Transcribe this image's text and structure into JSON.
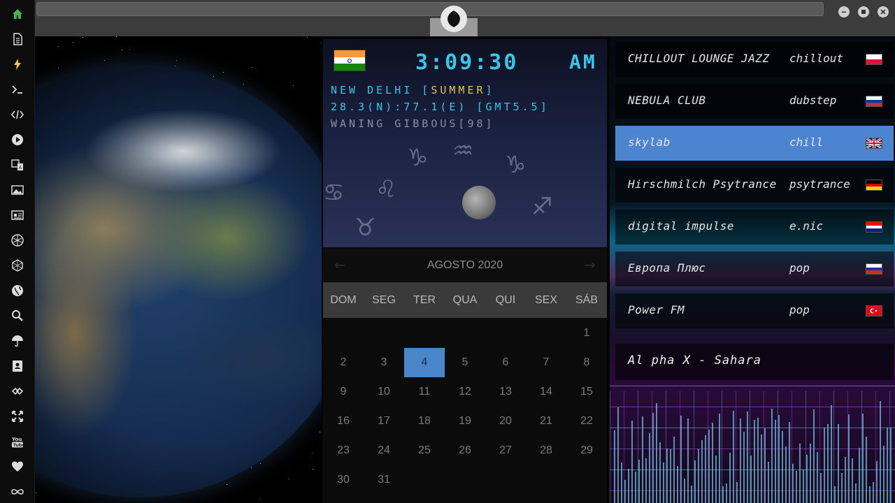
{
  "clock": {
    "time": "3:09:30",
    "ampm": "AM",
    "city_prefix": "NEW DELHI [",
    "season": "SUMMER",
    "city_suffix": "]",
    "coords": "28.3(N):77.1(E) [GMT5.5]",
    "moon": "WANING GIBBOUS[98]"
  },
  "calendar": {
    "month_label": "AGOSTO 2020",
    "weekdays": [
      "DOM",
      "SEG",
      "TER",
      "QUA",
      "QUI",
      "SEX",
      "SÁB"
    ],
    "today": 4,
    "days_in_month": 31,
    "first_weekday_index": 6,
    "prev_icon": "chevron-left-icon",
    "next_icon": "chevron-right-icon"
  },
  "radio": {
    "stations": [
      {
        "name": "CHILLOUT LOUNGE JAZZ",
        "genre": "chillout",
        "flag": "poland"
      },
      {
        "name": "NEBULA CLUB",
        "genre": "dubstep",
        "flag": "russia"
      },
      {
        "name": "skylab",
        "genre": "chill",
        "flag": "uk",
        "active": true
      },
      {
        "name": "Hirschmilch Psytrance",
        "genre": "psytrance",
        "flag": "germany"
      },
      {
        "name": "digital impulse",
        "genre": "e.nic",
        "flag": "croatia"
      },
      {
        "name": "Европа Плюс",
        "genre": "pop",
        "flag": "russia"
      },
      {
        "name": "Power FM",
        "genre": "pop",
        "flag": "turkey"
      }
    ],
    "now_playing": "Al pha X - Sahara"
  },
  "sidebar": {
    "icons": [
      "home-icon",
      "document-icon",
      "lightning-icon",
      "terminal-icon",
      "code-icon",
      "play-icon",
      "translate-icon",
      "image-icon",
      "news-icon",
      "rebel-alliance-icon",
      "hexagon-icon",
      "globe-icon",
      "search-icon",
      "umbrella-icon",
      "contacts-icon",
      "link-icon",
      "expand-icon",
      "youtube-icon",
      "heart-icon",
      "infinity-icon"
    ],
    "accent": "#4caf50",
    "lightning_color": "#f2c744"
  },
  "colors": {
    "clock_digits": "#3ac6ea",
    "season": "#e7c14a",
    "today_bg": "#4a86c8",
    "active_station": "#4d84cf"
  },
  "youtube_label": "You Tube"
}
